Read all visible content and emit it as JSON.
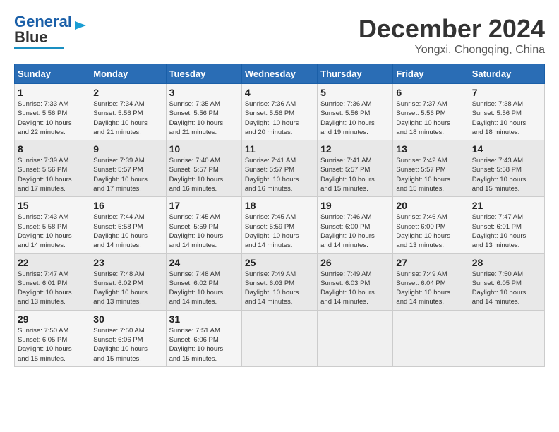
{
  "header": {
    "logo": {
      "line1": "General",
      "line2": "Blue"
    },
    "title": "December 2024",
    "location": "Yongxi, Chongqing, China"
  },
  "calendar": {
    "days_of_week": [
      "Sunday",
      "Monday",
      "Tuesday",
      "Wednesday",
      "Thursday",
      "Friday",
      "Saturday"
    ],
    "weeks": [
      [
        {
          "day": "",
          "info": ""
        },
        {
          "day": "2",
          "info": "Sunrise: 7:34 AM\nSunset: 5:56 PM\nDaylight: 10 hours\nand 21 minutes."
        },
        {
          "day": "3",
          "info": "Sunrise: 7:35 AM\nSunset: 5:56 PM\nDaylight: 10 hours\nand 21 minutes."
        },
        {
          "day": "4",
          "info": "Sunrise: 7:36 AM\nSunset: 5:56 PM\nDaylight: 10 hours\nand 20 minutes."
        },
        {
          "day": "5",
          "info": "Sunrise: 7:36 AM\nSunset: 5:56 PM\nDaylight: 10 hours\nand 19 minutes."
        },
        {
          "day": "6",
          "info": "Sunrise: 7:37 AM\nSunset: 5:56 PM\nDaylight: 10 hours\nand 18 minutes."
        },
        {
          "day": "7",
          "info": "Sunrise: 7:38 AM\nSunset: 5:56 PM\nDaylight: 10 hours\nand 18 minutes."
        }
      ],
      [
        {
          "day": "1",
          "info": "Sunrise: 7:33 AM\nSunset: 5:56 PM\nDaylight: 10 hours\nand 22 minutes."
        },
        {
          "day": "",
          "info": ""
        },
        {
          "day": "",
          "info": ""
        },
        {
          "day": "",
          "info": ""
        },
        {
          "day": "",
          "info": ""
        },
        {
          "day": "",
          "info": ""
        },
        {
          "day": "",
          "info": ""
        }
      ],
      [
        {
          "day": "8",
          "info": "Sunrise: 7:39 AM\nSunset: 5:56 PM\nDaylight: 10 hours\nand 17 minutes."
        },
        {
          "day": "9",
          "info": "Sunrise: 7:39 AM\nSunset: 5:57 PM\nDaylight: 10 hours\nand 17 minutes."
        },
        {
          "day": "10",
          "info": "Sunrise: 7:40 AM\nSunset: 5:57 PM\nDaylight: 10 hours\nand 16 minutes."
        },
        {
          "day": "11",
          "info": "Sunrise: 7:41 AM\nSunset: 5:57 PM\nDaylight: 10 hours\nand 16 minutes."
        },
        {
          "day": "12",
          "info": "Sunrise: 7:41 AM\nSunset: 5:57 PM\nDaylight: 10 hours\nand 15 minutes."
        },
        {
          "day": "13",
          "info": "Sunrise: 7:42 AM\nSunset: 5:57 PM\nDaylight: 10 hours\nand 15 minutes."
        },
        {
          "day": "14",
          "info": "Sunrise: 7:43 AM\nSunset: 5:58 PM\nDaylight: 10 hours\nand 15 minutes."
        }
      ],
      [
        {
          "day": "15",
          "info": "Sunrise: 7:43 AM\nSunset: 5:58 PM\nDaylight: 10 hours\nand 14 minutes."
        },
        {
          "day": "16",
          "info": "Sunrise: 7:44 AM\nSunset: 5:58 PM\nDaylight: 10 hours\nand 14 minutes."
        },
        {
          "day": "17",
          "info": "Sunrise: 7:45 AM\nSunset: 5:59 PM\nDaylight: 10 hours\nand 14 minutes."
        },
        {
          "day": "18",
          "info": "Sunrise: 7:45 AM\nSunset: 5:59 PM\nDaylight: 10 hours\nand 14 minutes."
        },
        {
          "day": "19",
          "info": "Sunrise: 7:46 AM\nSunset: 6:00 PM\nDaylight: 10 hours\nand 14 minutes."
        },
        {
          "day": "20",
          "info": "Sunrise: 7:46 AM\nSunset: 6:00 PM\nDaylight: 10 hours\nand 13 minutes."
        },
        {
          "day": "21",
          "info": "Sunrise: 7:47 AM\nSunset: 6:01 PM\nDaylight: 10 hours\nand 13 minutes."
        }
      ],
      [
        {
          "day": "22",
          "info": "Sunrise: 7:47 AM\nSunset: 6:01 PM\nDaylight: 10 hours\nand 13 minutes."
        },
        {
          "day": "23",
          "info": "Sunrise: 7:48 AM\nSunset: 6:02 PM\nDaylight: 10 hours\nand 13 minutes."
        },
        {
          "day": "24",
          "info": "Sunrise: 7:48 AM\nSunset: 6:02 PM\nDaylight: 10 hours\nand 14 minutes."
        },
        {
          "day": "25",
          "info": "Sunrise: 7:49 AM\nSunset: 6:03 PM\nDaylight: 10 hours\nand 14 minutes."
        },
        {
          "day": "26",
          "info": "Sunrise: 7:49 AM\nSunset: 6:03 PM\nDaylight: 10 hours\nand 14 minutes."
        },
        {
          "day": "27",
          "info": "Sunrise: 7:49 AM\nSunset: 6:04 PM\nDaylight: 10 hours\nand 14 minutes."
        },
        {
          "day": "28",
          "info": "Sunrise: 7:50 AM\nSunset: 6:05 PM\nDaylight: 10 hours\nand 14 minutes."
        }
      ],
      [
        {
          "day": "29",
          "info": "Sunrise: 7:50 AM\nSunset: 6:05 PM\nDaylight: 10 hours\nand 15 minutes."
        },
        {
          "day": "30",
          "info": "Sunrise: 7:50 AM\nSunset: 6:06 PM\nDaylight: 10 hours\nand 15 minutes."
        },
        {
          "day": "31",
          "info": "Sunrise: 7:51 AM\nSunset: 6:06 PM\nDaylight: 10 hours\nand 15 minutes."
        },
        {
          "day": "",
          "info": ""
        },
        {
          "day": "",
          "info": ""
        },
        {
          "day": "",
          "info": ""
        },
        {
          "day": "",
          "info": ""
        }
      ]
    ]
  }
}
